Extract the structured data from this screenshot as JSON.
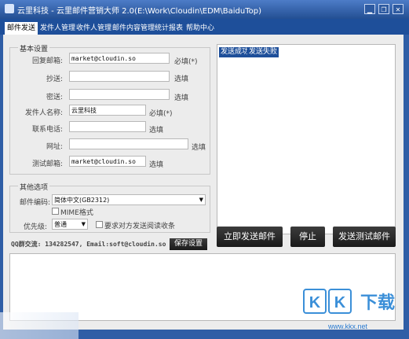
{
  "window": {
    "title": "云里科技 - 云里邮件营销大师 2.0(E:\\Work\\Cloudin\\EDM\\BaiduTop)",
    "controls": [
      "minimize-icon",
      "restore-icon",
      "close-icon"
    ]
  },
  "tabs": [
    {
      "label": "邮件发送",
      "active": true
    },
    {
      "label": "发件人管理",
      "active": false
    },
    {
      "label": "收件人管理",
      "active": false
    },
    {
      "label": "邮件内容管理",
      "active": false
    },
    {
      "label": "统计报表",
      "active": false
    },
    {
      "label": "帮助中心",
      "active": false
    }
  ],
  "basic": {
    "title": "基本设置",
    "reply_label": "回复邮箱:",
    "reply_value": "market@cloudin.so",
    "reply_hint": "必填(*)",
    "cc_label": "抄送:",
    "cc_hint": "选填",
    "bcc_label": "密送:",
    "bcc_hint": "选填",
    "sender_label": "发件人名称:",
    "sender_value": "云里科技",
    "sender_hint": "必填(*)",
    "phone_label": "联系电话:",
    "phone_hint": "选填",
    "url_label": "网址:",
    "url_hint": "选填",
    "test_label": "测试邮箱:",
    "test_value": "market@cloudin.so",
    "test_hint": "选填"
  },
  "other": {
    "title": "其他选项",
    "encoding_label": "邮件编码:",
    "encoding_value": "简体中文(GB2312)",
    "mime_label": "MIME格式",
    "priority_label": "优先级:",
    "priority_value": "普通",
    "receipt_label": "要求对方发送阅读收条"
  },
  "contact": {
    "text": "QQ群交流: 134282547, Email:soft@cloudin.so"
  },
  "save_button": "保存设置",
  "result_tabs": [
    "发送成功",
    "发送失败"
  ],
  "actions": {
    "send": "立即发送邮件",
    "stop": "停止",
    "test": "发送测试邮件"
  },
  "watermark": {
    "logo_text": "KK下载",
    "url": "www.kkx.net"
  }
}
